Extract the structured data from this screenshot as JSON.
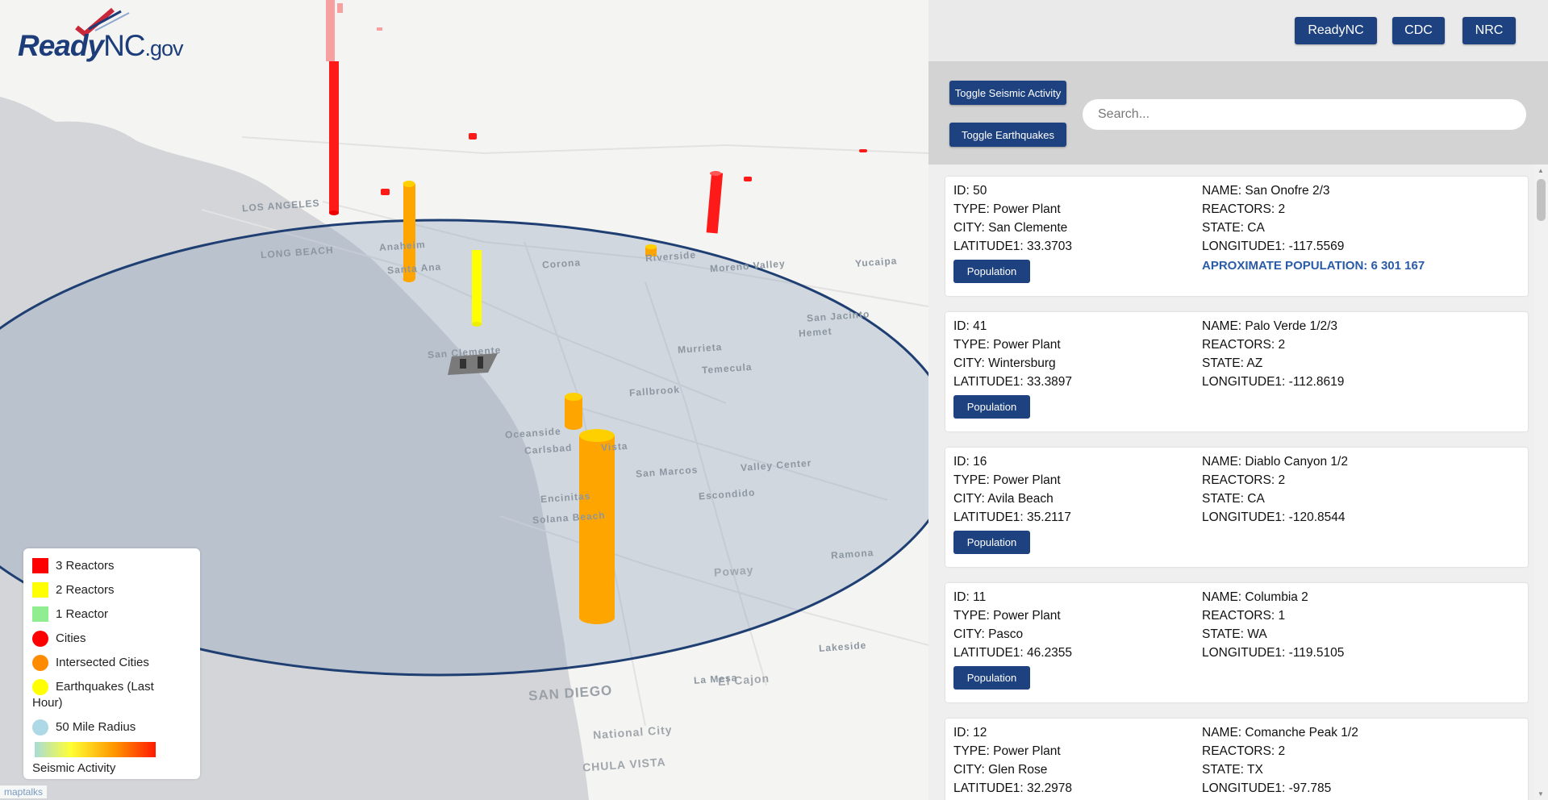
{
  "brand": {
    "part1": "Ready",
    "part2": "NC",
    "part3": ".gov"
  },
  "nav": [
    "ReadyNC",
    "CDC",
    "NRC"
  ],
  "controls": {
    "toggle_seismic": "Toggle Seismic Activity",
    "toggle_earthquakes": "Toggle Earthquakes",
    "search_placeholder": "Search..."
  },
  "legend": {
    "items": [
      {
        "label": "3 Reactors",
        "color": "#ff0000",
        "shape": "square"
      },
      {
        "label": "2 Reactors",
        "color": "#ffff00",
        "shape": "square"
      },
      {
        "label": "1 Reactor",
        "color": "#90ee90",
        "shape": "square"
      },
      {
        "label": "Cities",
        "color": "#ff0000",
        "shape": "circle"
      },
      {
        "label": "Intersected Cities",
        "color": "#ff8c00",
        "shape": "circle"
      },
      {
        "label": "Earthquakes (Last Hour)",
        "color": "#ffff00",
        "shape": "circle"
      },
      {
        "label": "50 Mile Radius",
        "color": "#add8e6",
        "shape": "circle"
      }
    ],
    "gradient_label": "Seismic Activity"
  },
  "map": {
    "labels": [
      "LOS ANGELES",
      "LONG BEACH",
      "Anaheim",
      "Santa Ana",
      "Corona",
      "Riverside",
      "Moreno Valley",
      "Temecula",
      "Murrieta",
      "Oceanside",
      "Carlsbad",
      "Vista",
      "San Marcos",
      "Escondido",
      "Valley Center",
      "Encinitas",
      "Solana Beach",
      "Poway",
      "Ramona",
      "Lakeside",
      "El Cajon",
      "La Mesa",
      "SAN DIEGO",
      "National City",
      "CHULA VISTA",
      "San Jacinto",
      "Hemet",
      "Yucaipa",
      "San Clemente",
      "Fallbrook"
    ],
    "attribution": "maptalks"
  },
  "labels": {
    "id": "ID:",
    "type": "TYPE:",
    "city": "CITY:",
    "lat": "LATITUDE1:",
    "name": "NAME:",
    "reactors": "REACTORS:",
    "state": "STATE:",
    "lon": "LONGITUDE1:",
    "population_button": "Population",
    "population_prefix": "APROXIMATE POPULATION:"
  },
  "plants": [
    {
      "id": "50",
      "type": "Power Plant",
      "city": "San Clemente",
      "lat": "33.3703",
      "name": "San Onofre 2/3",
      "reactors": "2",
      "state": "CA",
      "lon": "-117.5569",
      "population": "6 301 167"
    },
    {
      "id": "41",
      "type": "Power Plant",
      "city": "Wintersburg",
      "lat": "33.3897",
      "name": "Palo Verde 1/2/3",
      "reactors": "2",
      "state": "AZ",
      "lon": "-112.8619"
    },
    {
      "id": "16",
      "type": "Power Plant",
      "city": "Avila Beach",
      "lat": "35.2117",
      "name": "Diablo Canyon 1/2",
      "reactors": "2",
      "state": "CA",
      "lon": "-120.8544"
    },
    {
      "id": "11",
      "type": "Power Plant",
      "city": "Pasco",
      "lat": "46.2355",
      "name": "Columbia 2",
      "reactors": "1",
      "state": "WA",
      "lon": "-119.5105"
    },
    {
      "id": "12",
      "type": "Power Plant",
      "city": "Glen Rose",
      "lat": "32.2978",
      "name": "Comanche Peak 1/2",
      "reactors": "2",
      "state": "TX",
      "lon": "-97.785"
    }
  ]
}
